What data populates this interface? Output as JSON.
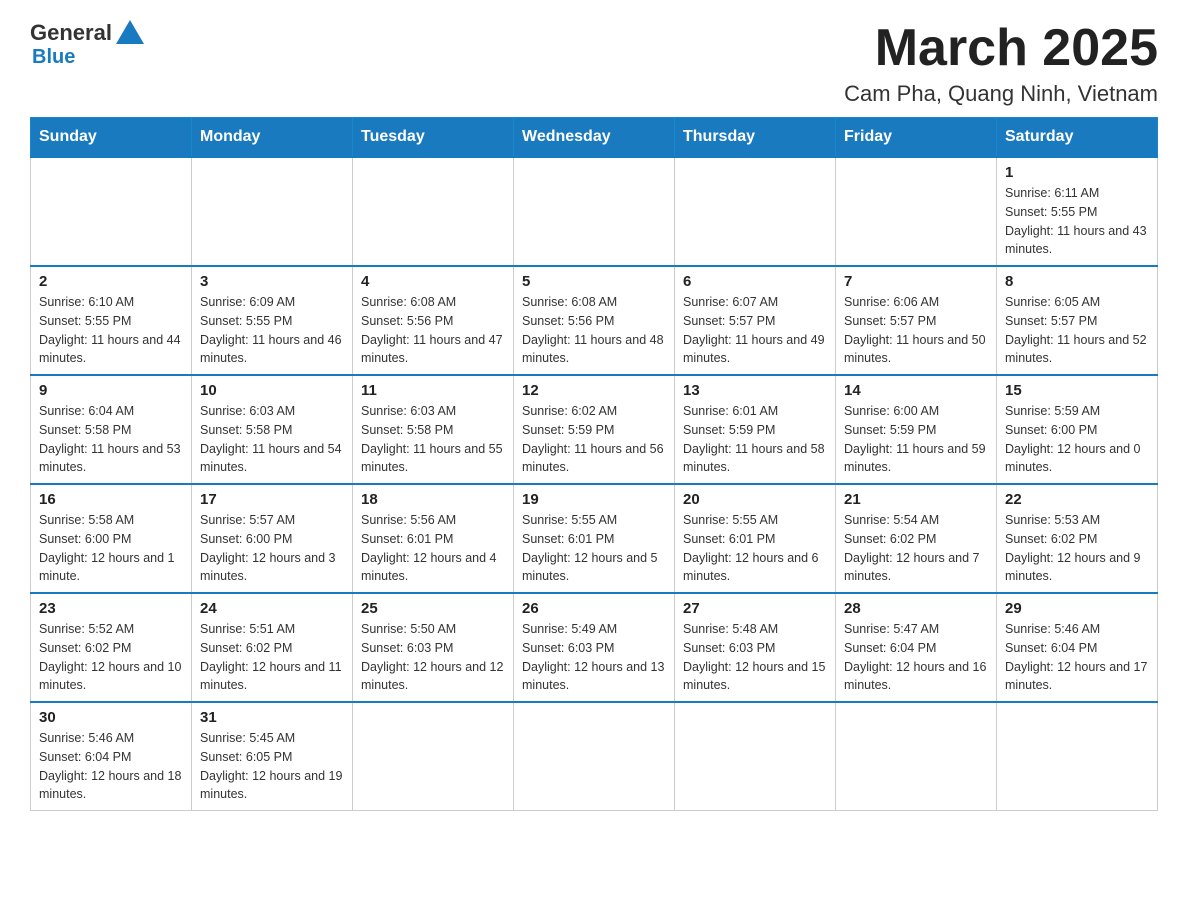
{
  "header": {
    "logo": {
      "general": "General",
      "blue": "Blue"
    },
    "title": "March 2025",
    "location": "Cam Pha, Quang Ninh, Vietnam"
  },
  "days_of_week": [
    "Sunday",
    "Monday",
    "Tuesday",
    "Wednesday",
    "Thursday",
    "Friday",
    "Saturday"
  ],
  "weeks": [
    [
      {
        "day": "",
        "info": ""
      },
      {
        "day": "",
        "info": ""
      },
      {
        "day": "",
        "info": ""
      },
      {
        "day": "",
        "info": ""
      },
      {
        "day": "",
        "info": ""
      },
      {
        "day": "",
        "info": ""
      },
      {
        "day": "1",
        "info": "Sunrise: 6:11 AM\nSunset: 5:55 PM\nDaylight: 11 hours and 43 minutes."
      }
    ],
    [
      {
        "day": "2",
        "info": "Sunrise: 6:10 AM\nSunset: 5:55 PM\nDaylight: 11 hours and 44 minutes."
      },
      {
        "day": "3",
        "info": "Sunrise: 6:09 AM\nSunset: 5:55 PM\nDaylight: 11 hours and 46 minutes."
      },
      {
        "day": "4",
        "info": "Sunrise: 6:08 AM\nSunset: 5:56 PM\nDaylight: 11 hours and 47 minutes."
      },
      {
        "day": "5",
        "info": "Sunrise: 6:08 AM\nSunset: 5:56 PM\nDaylight: 11 hours and 48 minutes."
      },
      {
        "day": "6",
        "info": "Sunrise: 6:07 AM\nSunset: 5:57 PM\nDaylight: 11 hours and 49 minutes."
      },
      {
        "day": "7",
        "info": "Sunrise: 6:06 AM\nSunset: 5:57 PM\nDaylight: 11 hours and 50 minutes."
      },
      {
        "day": "8",
        "info": "Sunrise: 6:05 AM\nSunset: 5:57 PM\nDaylight: 11 hours and 52 minutes."
      }
    ],
    [
      {
        "day": "9",
        "info": "Sunrise: 6:04 AM\nSunset: 5:58 PM\nDaylight: 11 hours and 53 minutes."
      },
      {
        "day": "10",
        "info": "Sunrise: 6:03 AM\nSunset: 5:58 PM\nDaylight: 11 hours and 54 minutes."
      },
      {
        "day": "11",
        "info": "Sunrise: 6:03 AM\nSunset: 5:58 PM\nDaylight: 11 hours and 55 minutes."
      },
      {
        "day": "12",
        "info": "Sunrise: 6:02 AM\nSunset: 5:59 PM\nDaylight: 11 hours and 56 minutes."
      },
      {
        "day": "13",
        "info": "Sunrise: 6:01 AM\nSunset: 5:59 PM\nDaylight: 11 hours and 58 minutes."
      },
      {
        "day": "14",
        "info": "Sunrise: 6:00 AM\nSunset: 5:59 PM\nDaylight: 11 hours and 59 minutes."
      },
      {
        "day": "15",
        "info": "Sunrise: 5:59 AM\nSunset: 6:00 PM\nDaylight: 12 hours and 0 minutes."
      }
    ],
    [
      {
        "day": "16",
        "info": "Sunrise: 5:58 AM\nSunset: 6:00 PM\nDaylight: 12 hours and 1 minute."
      },
      {
        "day": "17",
        "info": "Sunrise: 5:57 AM\nSunset: 6:00 PM\nDaylight: 12 hours and 3 minutes."
      },
      {
        "day": "18",
        "info": "Sunrise: 5:56 AM\nSunset: 6:01 PM\nDaylight: 12 hours and 4 minutes."
      },
      {
        "day": "19",
        "info": "Sunrise: 5:55 AM\nSunset: 6:01 PM\nDaylight: 12 hours and 5 minutes."
      },
      {
        "day": "20",
        "info": "Sunrise: 5:55 AM\nSunset: 6:01 PM\nDaylight: 12 hours and 6 minutes."
      },
      {
        "day": "21",
        "info": "Sunrise: 5:54 AM\nSunset: 6:02 PM\nDaylight: 12 hours and 7 minutes."
      },
      {
        "day": "22",
        "info": "Sunrise: 5:53 AM\nSunset: 6:02 PM\nDaylight: 12 hours and 9 minutes."
      }
    ],
    [
      {
        "day": "23",
        "info": "Sunrise: 5:52 AM\nSunset: 6:02 PM\nDaylight: 12 hours and 10 minutes."
      },
      {
        "day": "24",
        "info": "Sunrise: 5:51 AM\nSunset: 6:02 PM\nDaylight: 12 hours and 11 minutes."
      },
      {
        "day": "25",
        "info": "Sunrise: 5:50 AM\nSunset: 6:03 PM\nDaylight: 12 hours and 12 minutes."
      },
      {
        "day": "26",
        "info": "Sunrise: 5:49 AM\nSunset: 6:03 PM\nDaylight: 12 hours and 13 minutes."
      },
      {
        "day": "27",
        "info": "Sunrise: 5:48 AM\nSunset: 6:03 PM\nDaylight: 12 hours and 15 minutes."
      },
      {
        "day": "28",
        "info": "Sunrise: 5:47 AM\nSunset: 6:04 PM\nDaylight: 12 hours and 16 minutes."
      },
      {
        "day": "29",
        "info": "Sunrise: 5:46 AM\nSunset: 6:04 PM\nDaylight: 12 hours and 17 minutes."
      }
    ],
    [
      {
        "day": "30",
        "info": "Sunrise: 5:46 AM\nSunset: 6:04 PM\nDaylight: 12 hours and 18 minutes."
      },
      {
        "day": "31",
        "info": "Sunrise: 5:45 AM\nSunset: 6:05 PM\nDaylight: 12 hours and 19 minutes."
      },
      {
        "day": "",
        "info": ""
      },
      {
        "day": "",
        "info": ""
      },
      {
        "day": "",
        "info": ""
      },
      {
        "day": "",
        "info": ""
      },
      {
        "day": "",
        "info": ""
      }
    ]
  ]
}
